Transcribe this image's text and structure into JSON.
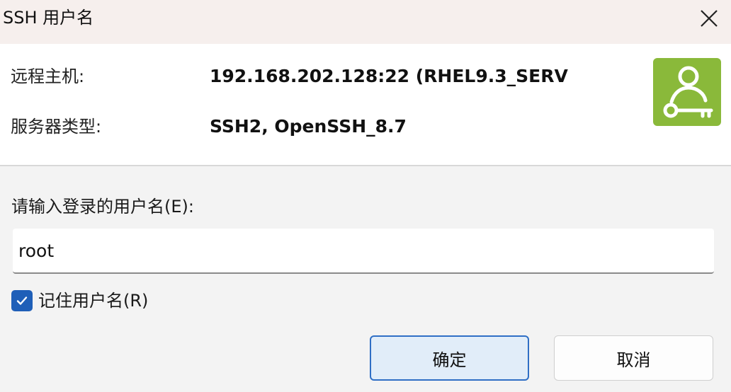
{
  "window": {
    "title": "SSH 用户名",
    "close_icon": "close-icon"
  },
  "info": {
    "host_label": "远程主机:",
    "host_value": "192.168.202.128:22 (RHEL9.3_SERV",
    "server_type_label": "服务器类型:",
    "server_type_value": "SSH2, OpenSSH_8.7",
    "logo_icon": "user-key-icon",
    "logo_color": "#8ab93a"
  },
  "form": {
    "username_prompt": "请输入登录的用户名(E):",
    "username_value": "root",
    "remember_label": "记住用户名(R)",
    "remember_checked": true
  },
  "buttons": {
    "ok_label": "确定",
    "cancel_label": "取消"
  },
  "colors": {
    "accent": "#2f6fc5",
    "checkbox": "#1f5fb8",
    "titlebar": "#f6efed"
  }
}
